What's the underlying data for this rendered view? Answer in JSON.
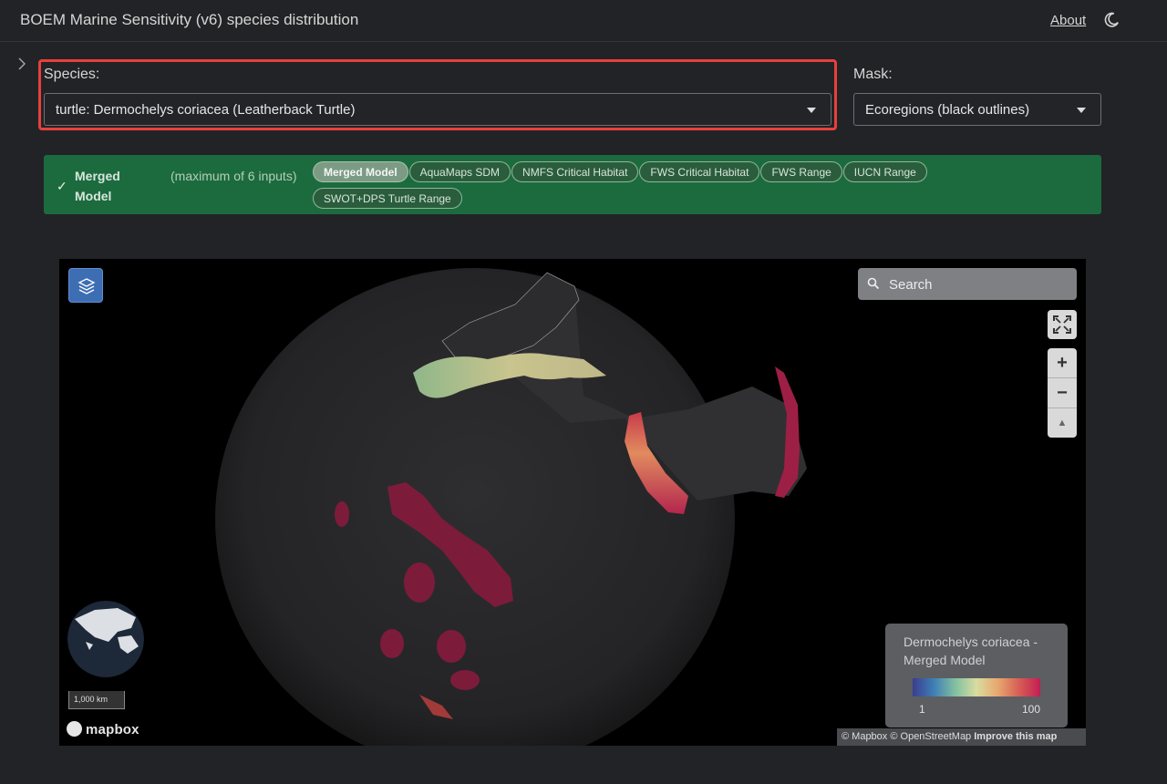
{
  "header": {
    "title": "BOEM Marine Sensitivity (v6) species distribution",
    "about_label": "About"
  },
  "species": {
    "label": "Species:",
    "selected": "turtle: Dermochelys coriacea (Leatherback Turtle)"
  },
  "mask": {
    "label": "Mask:",
    "selected": "Ecoregions (black outlines)"
  },
  "model_banner": {
    "check": "✓",
    "title": "Merged Model",
    "subtitle": "(maximum of 6 inputs)",
    "chips": [
      {
        "label": "Merged Model",
        "active": true
      },
      {
        "label": "AquaMaps SDM",
        "active": false
      },
      {
        "label": "NMFS Critical Habitat",
        "active": false
      },
      {
        "label": "FWS Critical Habitat",
        "active": false
      },
      {
        "label": "FWS Range",
        "active": false
      },
      {
        "label": "IUCN Range",
        "active": false
      },
      {
        "label": "SWOT+DPS Turtle Range",
        "active": false
      }
    ]
  },
  "map": {
    "search_placeholder": "Search",
    "zoom_in": "+",
    "zoom_out": "−",
    "compass": "▲",
    "scale_label": "1,000 km",
    "logo_text": "mapbox",
    "legend": {
      "title": "Dermochelys coriacea - Merged Model",
      "min": "1",
      "max": "100"
    },
    "attribution": {
      "mapbox": "© Mapbox",
      "osm": "© OpenStreetMap",
      "improve": "Improve this map"
    }
  },
  "colors": {
    "banner_green": "#1c6b3f",
    "highlight_red": "#e8403a",
    "habitat_high": "#8e1f45",
    "habitat_low": "#8fb78a"
  }
}
